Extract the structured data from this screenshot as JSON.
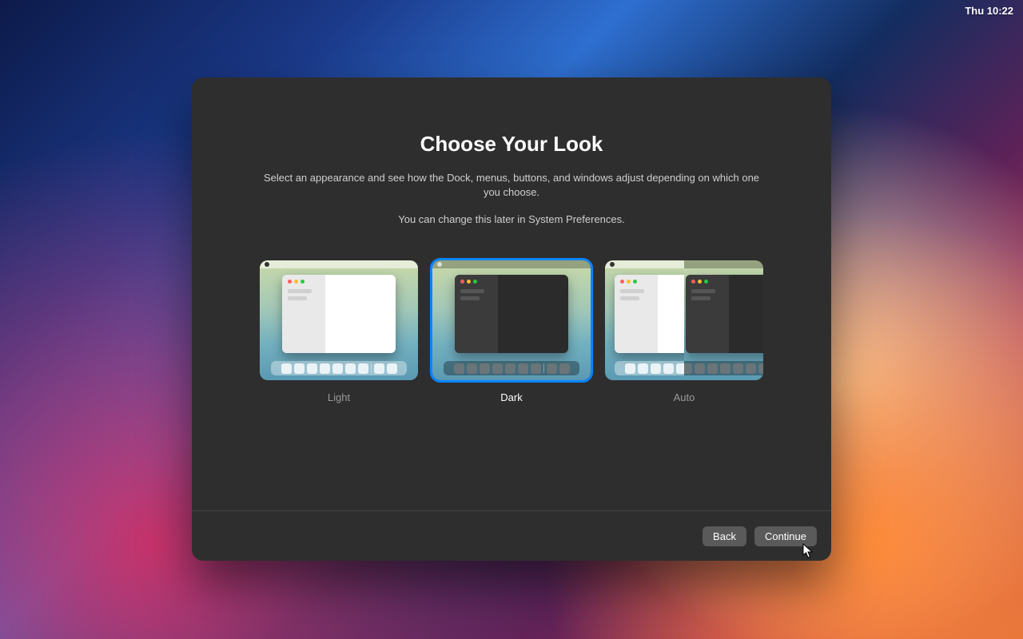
{
  "menubar": {
    "clock": "Thu 10:22"
  },
  "dialog": {
    "title": "Choose Your Look",
    "subtitle": "Select an appearance and see how the Dock, menus, buttons, and windows adjust depending on which one you choose.",
    "hint": "You can change this later in System Preferences.",
    "selected": "dark",
    "options": {
      "light": {
        "label": "Light"
      },
      "dark": {
        "label": "Dark"
      },
      "auto": {
        "label": "Auto"
      }
    },
    "buttons": {
      "back": "Back",
      "continue": "Continue"
    }
  }
}
